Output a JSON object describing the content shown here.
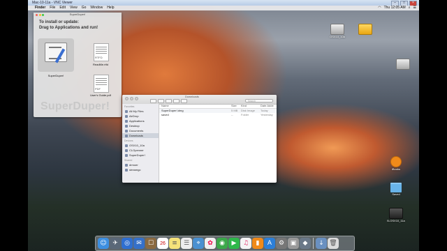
{
  "vnc": {
    "title": "Mac-10-11a - VNC Viewer"
  },
  "menubar": {
    "apple": "",
    "items": [
      "Finder",
      "File",
      "Edit",
      "View",
      "Go",
      "Window",
      "Help"
    ],
    "clock": "Thu 12:05 AM"
  },
  "dmg_window": {
    "title": "SuperDuper!",
    "instructions_line1": "To install or update:",
    "instructions_line2": "Drag to Applications and run!",
    "app_label": "SuperDuper!",
    "readme_tag": "RTFD",
    "readme_label": "ReadMe.rtfd",
    "guide_tag": "PDF",
    "guide_label": "User's Guide.pdf",
    "big_title": "SuperDuper!"
  },
  "finder": {
    "title": "Downloads",
    "search_placeholder": "Search",
    "sidebar": {
      "favorites_header": "Favorites",
      "favorites": [
        "All My Files",
        "AirDrop",
        "Applications",
        "Desktop",
        "Documents",
        "Downloads"
      ],
      "devices_header": "Devices",
      "devices": [
        "OSX10_10a",
        "CLOpenner",
        "SuperDuper!"
      ],
      "shared_header": "Shared",
      "shared": [
        "drmoer",
        "streamgc"
      ]
    },
    "columns": {
      "name": "Name",
      "size": "Size",
      "kind": "Kind",
      "date": "Date Adde"
    },
    "rows": [
      {
        "name": "SuperDuper!.dmg",
        "size": "5 MB",
        "kind": "Disk Image",
        "date": "Today"
      },
      {
        "name": "saved",
        "size": "--",
        "kind": "Folder",
        "date": "Yesterday"
      }
    ]
  },
  "desktop_icons": {
    "disk1": "OSX10_10a",
    "disk2": "",
    "disk3": "",
    "ibooks": "iBooks",
    "saved": "Saved",
    "osx_bottom": "B-OSX10_11a"
  },
  "dock": {
    "calendar_day": "26"
  }
}
